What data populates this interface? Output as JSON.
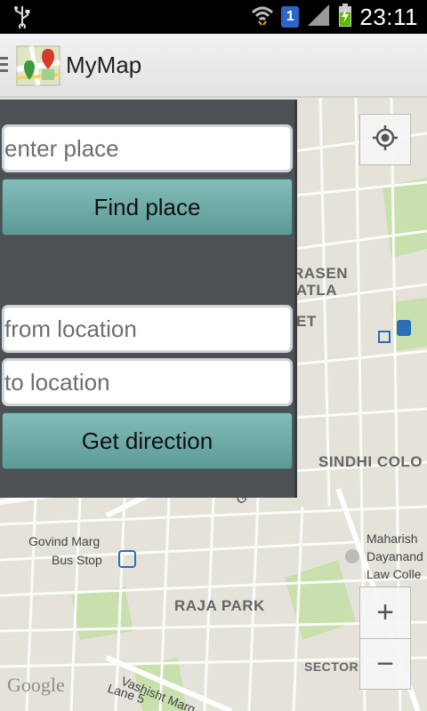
{
  "status_bar": {
    "time": "23:11",
    "sim_badge": "1",
    "icons": [
      "usb-icon",
      "wifi-icon",
      "signal-icon",
      "battery-charging-icon"
    ]
  },
  "action_bar": {
    "title": "MyMap",
    "icon": "map-app-icon"
  },
  "panel": {
    "search_placeholder": "enter place",
    "find_button": "Find place",
    "from_placeholder": "from location",
    "to_placeholder": "to location",
    "direction_button": "Get direction"
  },
  "map": {
    "labels": {
      "rasen": "RASEN",
      "atla": "ATLA",
      "et": "ET",
      "sindhi": "SINDHI COLO",
      "govind_1": "Govind Marg",
      "govind_2": "Bus Stop",
      "maharish_1": "Maharish",
      "maharish_2": "Dayanand",
      "maharish_3": "Law Colle",
      "raja_park": "RAJA PARK",
      "sector": "SECTOR",
      "vashisht": "Vashisht Marg",
      "lane5": "Lane 5",
      "go": "Go"
    },
    "zoom_in": "+",
    "zoom_out": "−",
    "attribution": "Google"
  }
}
